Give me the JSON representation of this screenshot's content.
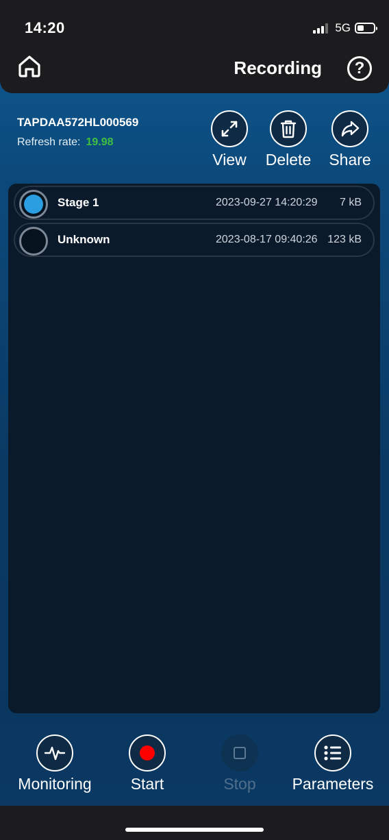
{
  "status_bar": {
    "time": "14:20",
    "network": "5G"
  },
  "header": {
    "title": "Recording",
    "help_label": "?"
  },
  "device": {
    "id": "TAPDAA572HL000569",
    "refresh_label": "Refresh rate:",
    "refresh_value": "19.98"
  },
  "actions": {
    "view": "View",
    "delete": "Delete",
    "share": "Share"
  },
  "recordings": [
    {
      "name": "Stage 1",
      "date": "2023-09-27 14:20:29",
      "size": "7 kB",
      "selected": true
    },
    {
      "name": "Unknown",
      "date": "2023-08-17 09:40:26",
      "size": "123 kB",
      "selected": false
    }
  ],
  "bottom_nav": {
    "monitoring": "Monitoring",
    "start": "Start",
    "stop": "Stop",
    "parameters": "Parameters"
  },
  "colors": {
    "accent_blue": "#2a9ee0",
    "refresh_green": "#40c040",
    "record_red": "#ff0000"
  }
}
